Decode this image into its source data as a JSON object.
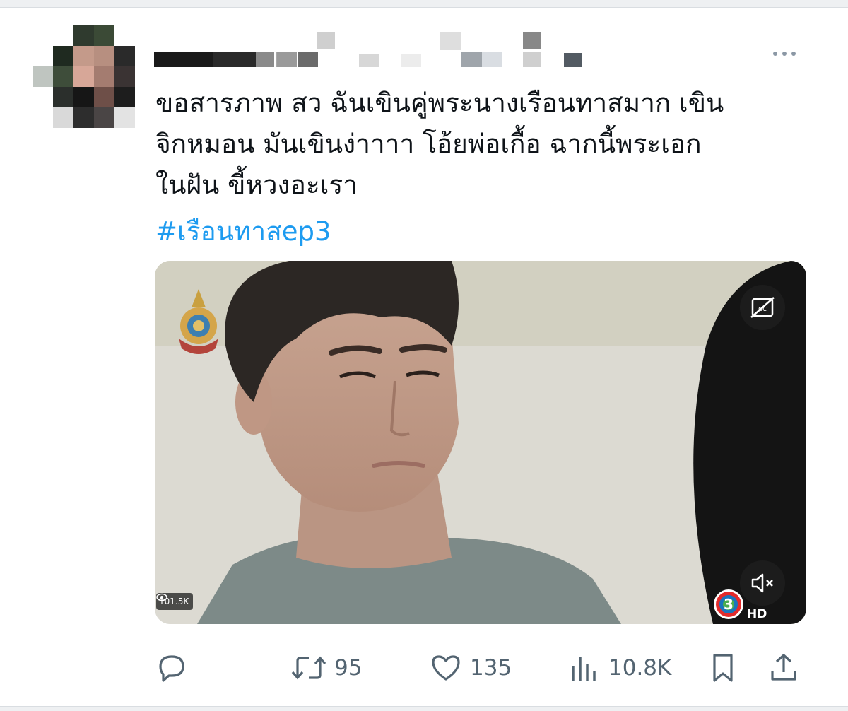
{
  "tweet": {
    "text": "ขอสารภาพ สว ฉันเขินคู่พระนางเรือนทาสมาก เขิน\nจิกหมอน มันเขินง่าาาา โอ้ยพ่อเกื้อ ฉากนี้พระเอก\nในฝัน ขี้หวงอะเรา",
    "hashtag": "#เรือนทาสep3"
  },
  "media": {
    "view_count": "101.5K",
    "channel_badge": "HD"
  },
  "actions": {
    "reply": {
      "icon": "reply-icon",
      "count": ""
    },
    "retweet": {
      "icon": "retweet-icon",
      "count": "95"
    },
    "like": {
      "icon": "heart-icon",
      "count": "135"
    },
    "views": {
      "icon": "analytics-icon",
      "count": "10.8K"
    },
    "bookmark": {
      "icon": "bookmark-icon"
    },
    "share": {
      "icon": "share-icon"
    }
  },
  "colors": {
    "text": "#0f1419",
    "link": "#1d9bf0",
    "muted": "#536471"
  }
}
